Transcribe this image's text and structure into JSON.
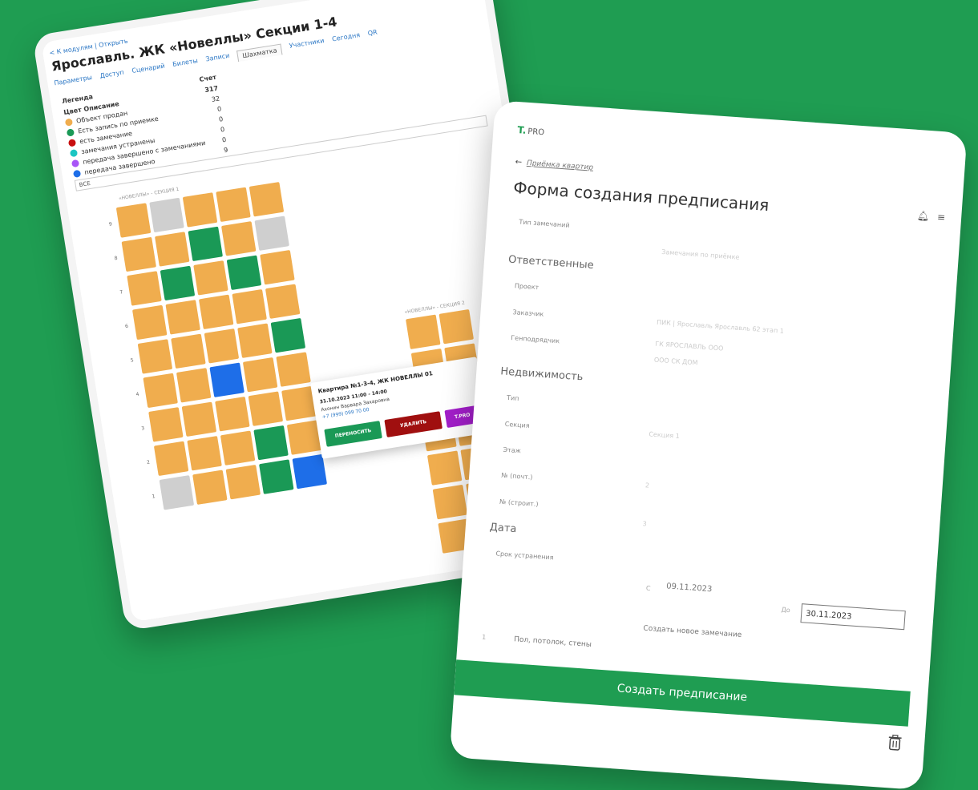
{
  "left": {
    "breadcrumb": "< К модулям | Открыть",
    "title": "Ярославль. ЖК «Новеллы» Секции 1-4",
    "tabs": [
      "Параметры",
      "Доступ",
      "Сценарий",
      "Билеты",
      "Записи",
      "Шахматка",
      "Участники",
      "Сегодня",
      "QR"
    ],
    "active_tab_index": 5,
    "legend": {
      "title": "Легенда",
      "col_color": "Цвет",
      "col_desc": "Описание",
      "col_count": "Счет",
      "total": "317",
      "items": [
        {
          "label": "Объект продан",
          "count": "32",
          "color": "#f0ad4e"
        },
        {
          "label": "Есть запись по приемке",
          "count": "0",
          "color": "#1a9956"
        },
        {
          "label": "есть замечание",
          "count": "0",
          "color": "#c80f0f"
        },
        {
          "label": "замечания устранены",
          "count": "0",
          "color": "#1bc5c2"
        },
        {
          "label": "передача завершено с замечаниями",
          "count": "0",
          "color": "#a855f7"
        },
        {
          "label": "передача завершено",
          "count": "9",
          "color": "#1e6ee8"
        }
      ]
    },
    "filter_value": "ВСЕ",
    "section1_label": "«НОВЕЛЛЫ» - СЕКЦИЯ 1",
    "section2_label": "«НОВЕЛЛЫ» - СЕКЦИЯ 2",
    "floors": [
      "9",
      "8",
      "7",
      "6",
      "5",
      "4",
      "3",
      "2",
      "1"
    ],
    "popup": {
      "heading": "Квартира №1-3-4, ЖК НОВЕЛЛЫ 01",
      "time": "31.10.2023 11:00 - 14:00",
      "name": "Ахонин Варвара Захаровна",
      "phone": "+7 (999) 099 70 00",
      "btn_move": "ПЕРЕНОСИТЬ",
      "btn_delete": "УДАЛИТЬ",
      "btn_tpro": "T.PRO"
    }
  },
  "right": {
    "logo": "T.",
    "logo_suffix": "PRO",
    "back_link": "Приёмка квартир",
    "title": "Форма создания предписания",
    "fields": {
      "remark_type_label": "Тип замечаний",
      "remark_type_value": "Замечания по приёмке",
      "section_responsible": "Ответственные",
      "project_label": "Проект",
      "customer_label": "Заказчик",
      "customer_value": "ПИК | Ярославль Ярославль 62 этап 1",
      "contractor_label": "Генподрядчик",
      "contractor_value": "ГК ЯРОСЛАВЛЬ ООО",
      "contractor_value2": "ООО СК ДОМ",
      "section_property": "Недвижимость",
      "type_label": "Тип",
      "section_label": "Секция",
      "section_value": "Секция 1",
      "floor_label": "Этаж",
      "num_post_label": "№ (почт.)",
      "num_post_value": "2",
      "num_build_label": "№ (строит.)",
      "num_build_value": "3",
      "section_date": "Дата",
      "deadline_label": "Срок устранения",
      "from_label": "С",
      "from_value": "09.11.2023",
      "to_label": "До",
      "to_value": "30.11.2023",
      "new_remark": "Создать новое замечание",
      "item_number": "1",
      "item_text": "Пол, потолок, стены"
    },
    "create_button": "Создать предписание"
  },
  "colors": {
    "background": "#1f9d52",
    "sold": "#f0ad4e",
    "booked": "#1a9956",
    "remark": "#c80f0f",
    "done": "#1e6ee8",
    "empty": "#cfcfcf"
  }
}
